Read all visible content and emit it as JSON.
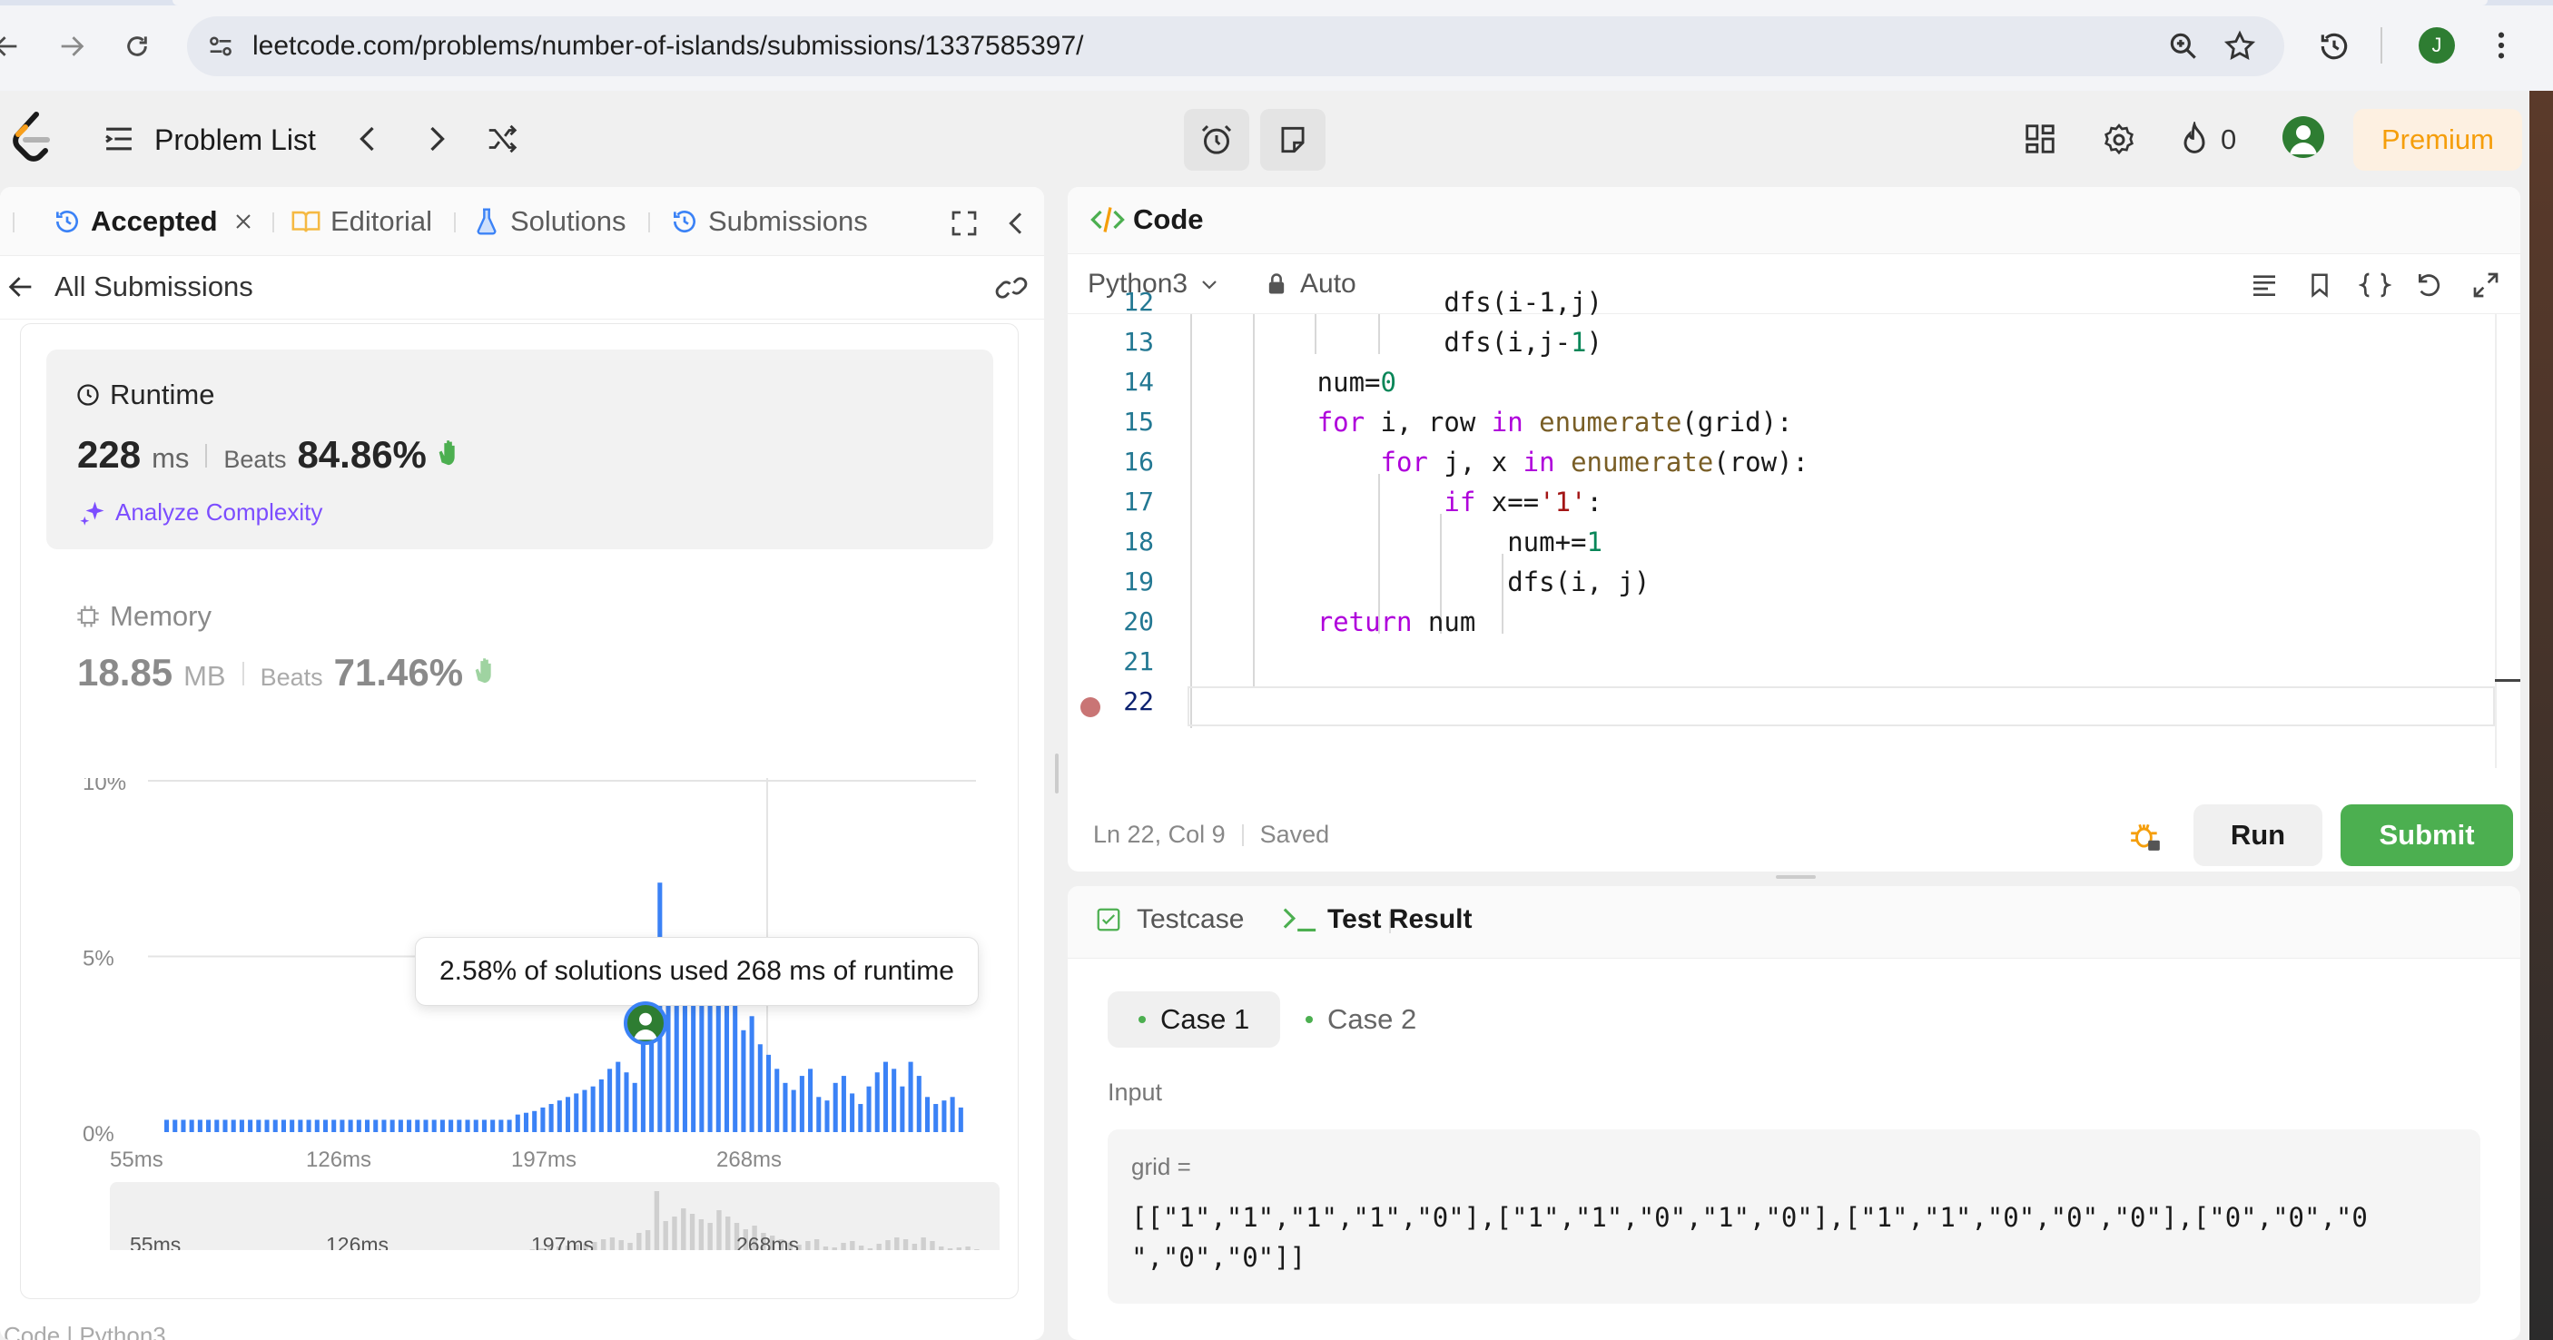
{
  "browser": {
    "url_host": "leetcode.com",
    "url_path": "/problems/number-of-islands/submissions/1337585397/",
    "profile_initial": "J"
  },
  "topbar": {
    "problem_list": "Problem List",
    "streak_count": "0",
    "premium": "Premium"
  },
  "left_tabs": {
    "accepted": "Accepted",
    "editorial": "Editorial",
    "solutions": "Solutions",
    "submissions": "Submissions"
  },
  "all_submissions": "All Submissions",
  "runtime": {
    "label": "Runtime",
    "value": "228",
    "unit": "ms",
    "beats_label": "Beats",
    "beats_value": "84.86%",
    "analyze": "Analyze Complexity"
  },
  "memory": {
    "label": "Memory",
    "value": "18.85",
    "unit": "MB",
    "beats_label": "Beats",
    "beats_value": "71.46%"
  },
  "tooltip": "2.58% of solutions used 268 ms of runtime",
  "chart_data": {
    "type": "bar",
    "y_tick_labels": [
      "10%",
      "5%",
      "0%"
    ],
    "x_tick_labels": [
      "55ms",
      "126ms",
      "197ms",
      "268ms"
    ],
    "ylim": [
      0,
      10
    ],
    "values": [
      0.35,
      0.35,
      0.35,
      0.35,
      0.35,
      0.35,
      0.35,
      0.35,
      0.35,
      0.35,
      0.35,
      0.35,
      0.35,
      0.35,
      0.35,
      0.35,
      0.35,
      0.35,
      0.35,
      0.35,
      0.35,
      0.35,
      0.35,
      0.35,
      0.35,
      0.35,
      0.35,
      0.35,
      0.35,
      0.35,
      0.35,
      0.35,
      0.35,
      0.35,
      0.35,
      0.35,
      0.35,
      0.35,
      0.35,
      0.35,
      0.35,
      0.35,
      0.5,
      0.55,
      0.6,
      0.7,
      0.8,
      0.9,
      1.0,
      1.1,
      1.2,
      1.3,
      1.5,
      1.8,
      2.0,
      1.7,
      1.4,
      2.5,
      2.8,
      7.1,
      3.8,
      4.3,
      5.2,
      4.6,
      4.0,
      3.6,
      5.0,
      4.3,
      3.6,
      2.9,
      3.3,
      2.5,
      2.2,
      1.8,
      1.4,
      1.2,
      1.6,
      1.8,
      1.0,
      0.9,
      1.4,
      1.6,
      1.1,
      0.8,
      1.3,
      1.7,
      2.0,
      1.8,
      1.3,
      2.0,
      1.6,
      1.0,
      0.8,
      0.9,
      1.0,
      0.7
    ],
    "highlight_value": "268ms"
  },
  "code_panel": {
    "title": "Code",
    "language": "Python3",
    "mode": "Auto",
    "lines": [
      {
        "n": "12",
        "text": "                dfs(i-1,j)"
      },
      {
        "n": "13",
        "text": "                dfs(i,j-1)"
      },
      {
        "n": "14",
        "text": "        num=0"
      },
      {
        "n": "15",
        "text": "        for i, row in enumerate(grid):"
      },
      {
        "n": "16",
        "text": "            for j, x in enumerate(row):"
      },
      {
        "n": "17",
        "text": "                if x=='1':"
      },
      {
        "n": "18",
        "text": "                    num+=1"
      },
      {
        "n": "19",
        "text": "                    dfs(i, j)"
      },
      {
        "n": "20",
        "text": "        return num"
      },
      {
        "n": "21",
        "text": ""
      },
      {
        "n": "22",
        "text": ""
      }
    ],
    "cursor_status": "Ln 22, Col 9",
    "save_status": "Saved",
    "run": "Run",
    "submit": "Submit"
  },
  "test_panel": {
    "testcase_tab": "Testcase",
    "result_tab": "Test Result",
    "case1": "Case 1",
    "case2": "Case 2",
    "input_label": "Input",
    "var_name": "grid =",
    "value_line1": "[[\"1\",\"1\",\"1\",\"1\",\"0\"],[\"1\",\"1\",\"0\",\"1\",\"0\"],[\"1\",\"1\",\"0\",\"0\",\"0\"],[\"0\",\"0\",\"0",
    "value_line2": "\",\"0\",\"0\"]]"
  },
  "colors": {
    "accent_green": "#4caf50",
    "premium_orange": "#f59e0b",
    "bar_blue": "#3b82f6",
    "analyze_purple": "#7c4dff"
  }
}
